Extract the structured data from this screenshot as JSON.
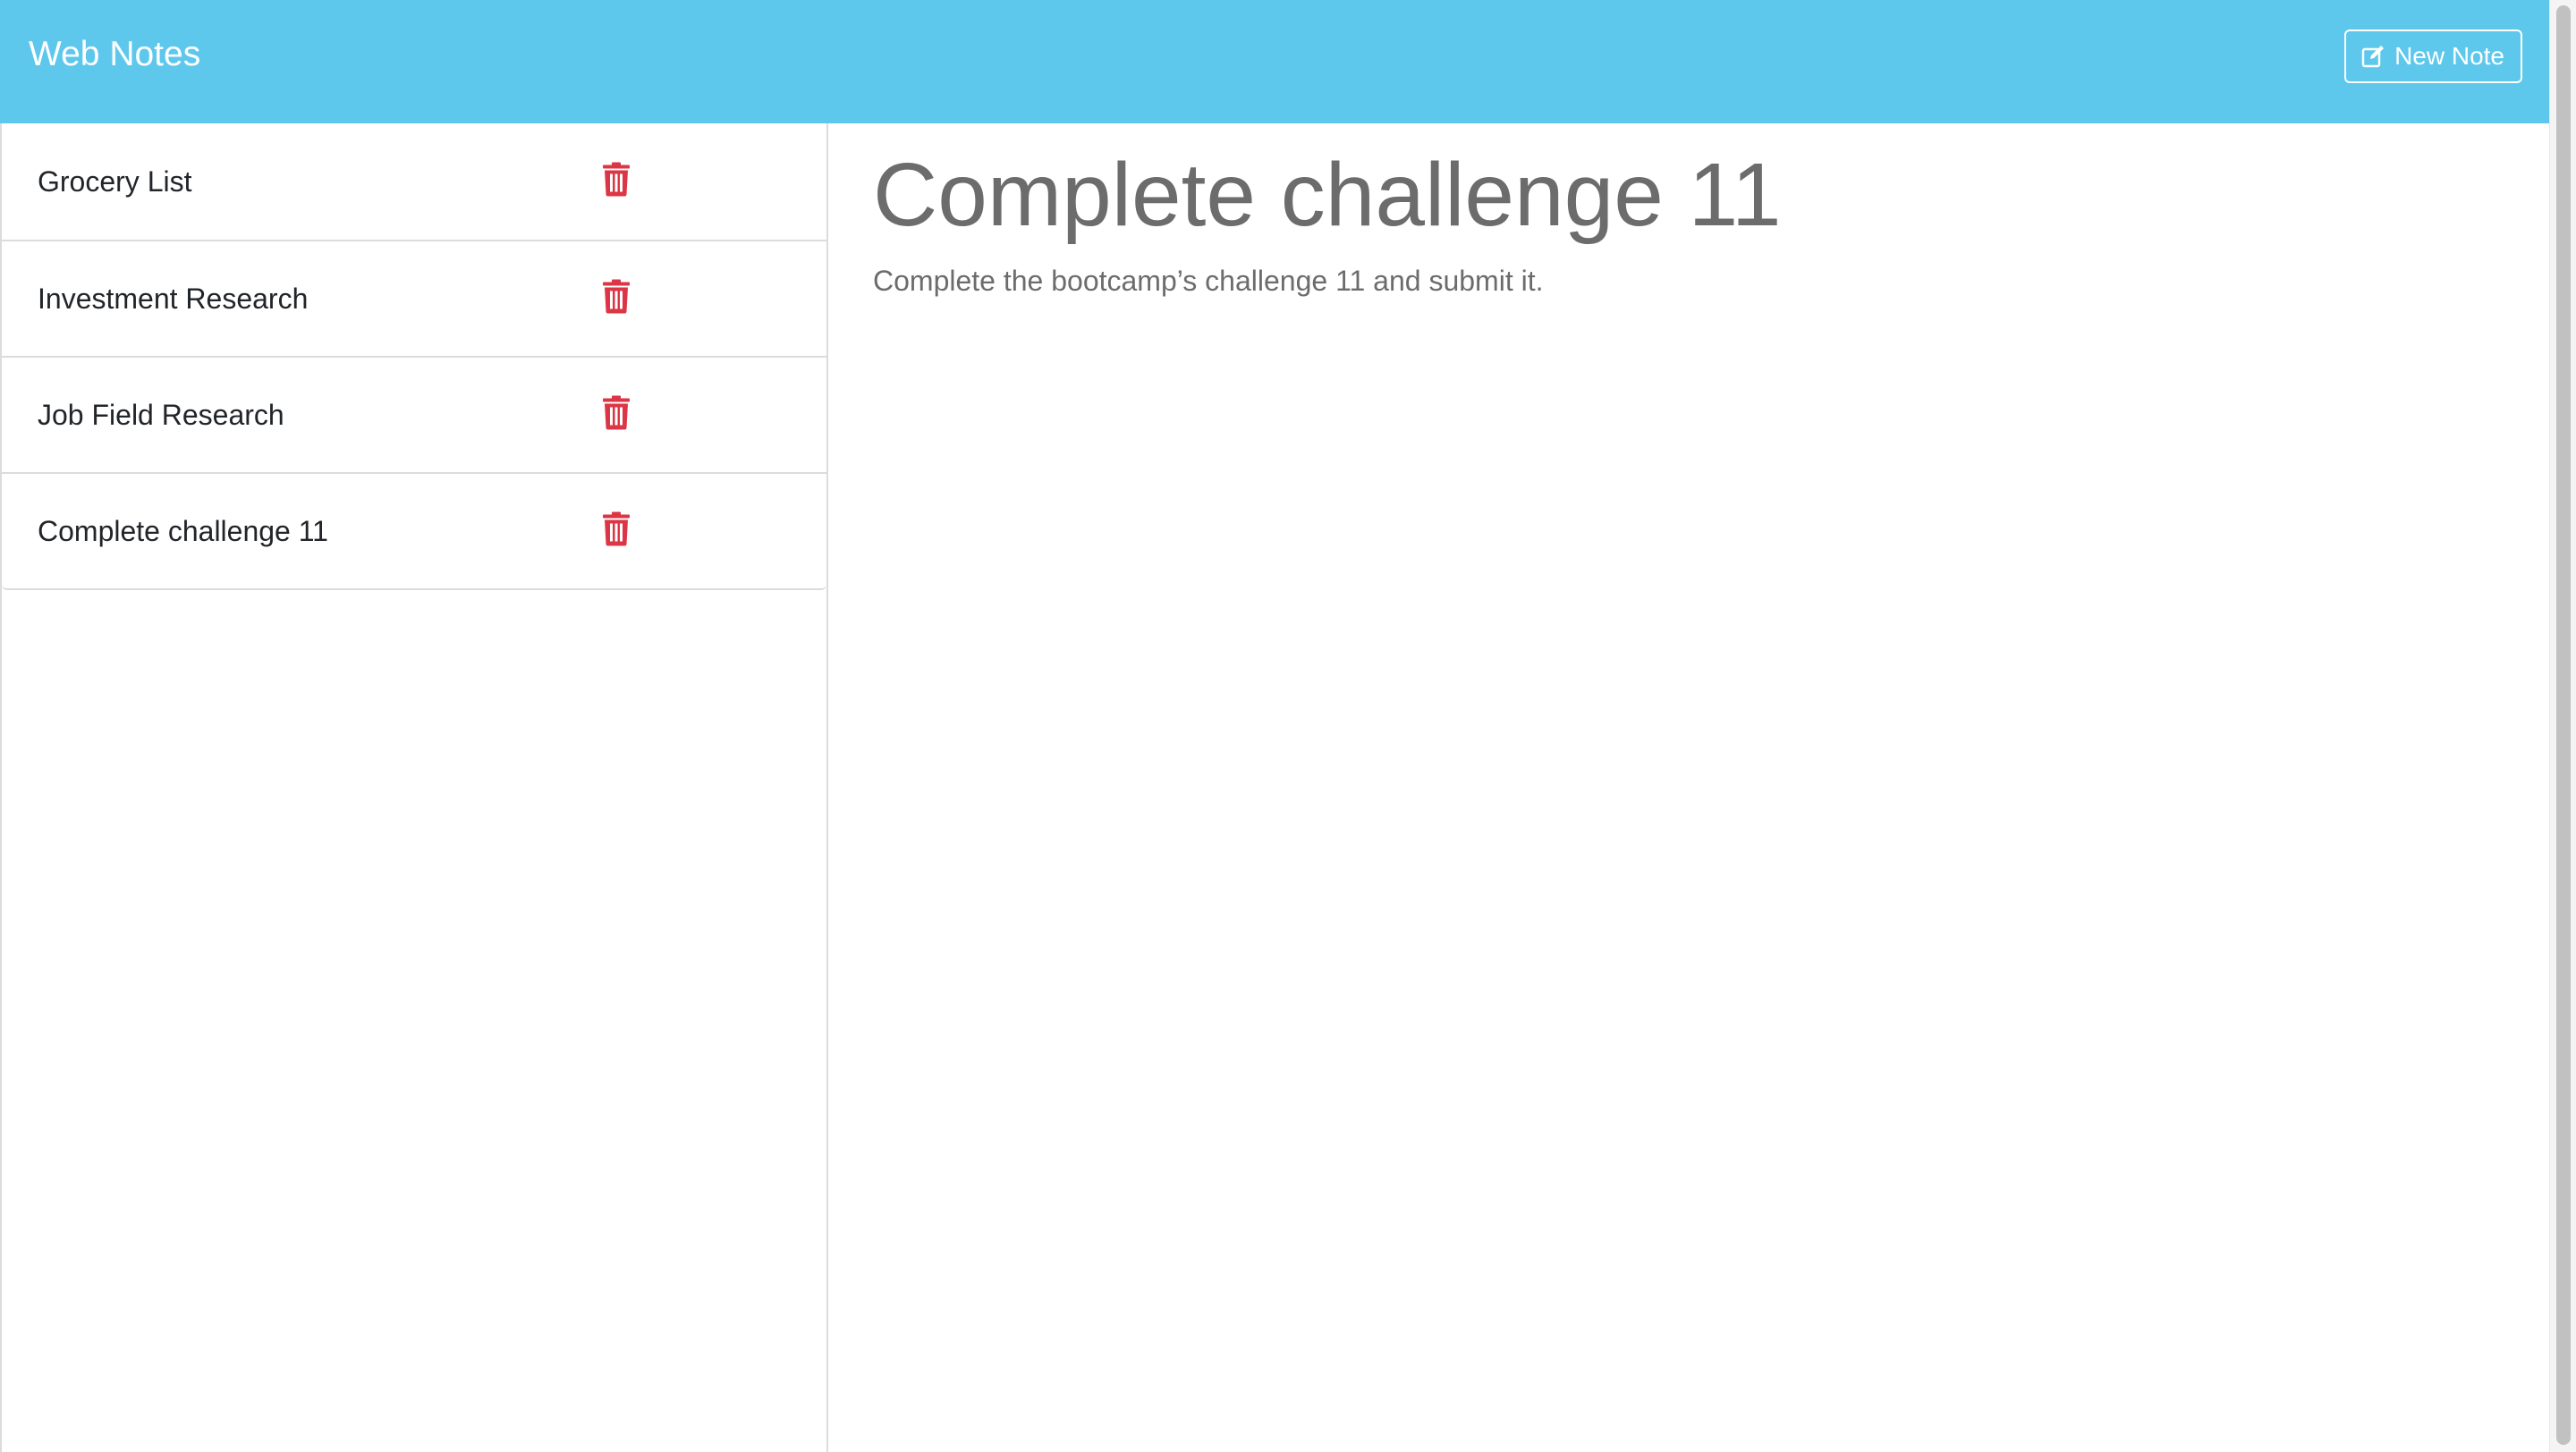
{
  "app": {
    "brand": "Web Notes",
    "new_note_label": "New Note"
  },
  "notes": [
    {
      "title": "Grocery List"
    },
    {
      "title": "Investment Research"
    },
    {
      "title": "Job Field Research"
    },
    {
      "title": "Complete challenge 11"
    }
  ],
  "active_note": {
    "title": "Complete challenge 11",
    "text": "Complete the bootcamp’s challenge 11 and submit it."
  },
  "colors": {
    "navbar": "#5ec8ec",
    "delete_icon": "#dc3545",
    "note_text": "#6c6c6c"
  },
  "icons": {
    "new_note": "pencil-square-icon",
    "delete": "trash-icon"
  }
}
